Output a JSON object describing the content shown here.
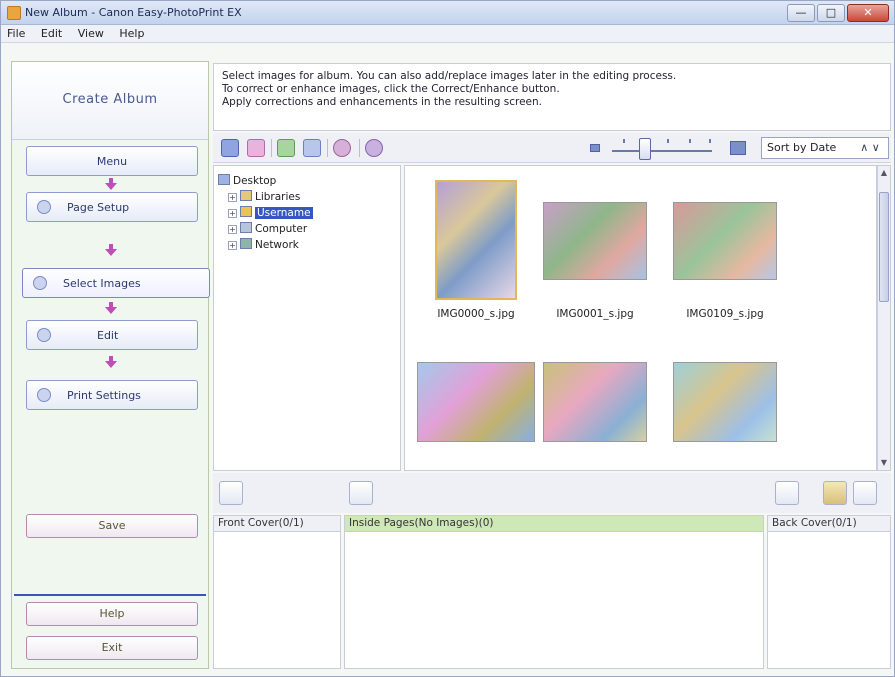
{
  "window": {
    "title": "New Album - Canon Easy-PhotoPrint EX",
    "buttons": {
      "minimize": "—",
      "maximize": "□",
      "close": "✕"
    }
  },
  "menu": [
    "File",
    "Edit",
    "View",
    "Help"
  ],
  "sidebar": {
    "header": "Create Album",
    "steps": [
      {
        "label": "Menu"
      },
      {
        "label": "Page Setup"
      },
      {
        "label": "Select Images"
      },
      {
        "label": "Edit"
      },
      {
        "label": "Print Settings"
      }
    ],
    "save_label": "Save",
    "help_label": "Help",
    "exit_label": "Exit"
  },
  "instructions": {
    "line1": "Select images for album. You can also add/replace images later in the editing process.",
    "line2": "To correct or enhance images, click the Correct/Enhance button.",
    "line3": "Apply corrections and enhancements in the resulting screen."
  },
  "toolbar": {
    "sort": {
      "selected": "Sort by Date",
      "chevron": "∧  ∨"
    },
    "zoom_level": 2
  },
  "tree": {
    "items": [
      {
        "label": "Desktop",
        "exp": ""
      },
      {
        "label": "Libraries",
        "exp": "+"
      },
      {
        "label": "Username",
        "exp": "+"
      },
      {
        "label": "Computer",
        "exp": "+"
      },
      {
        "label": "Network",
        "exp": "+"
      }
    ]
  },
  "thumbnails": [
    {
      "label": "IMG0000_s.jpg",
      "selected": true
    },
    {
      "label": "IMG0001_s.jpg",
      "selected": false
    },
    {
      "label": "IMG0109_s.jpg",
      "selected": false
    },
    {
      "label": "",
      "selected": false
    },
    {
      "label": "",
      "selected": false
    },
    {
      "label": "",
      "selected": false
    }
  ],
  "panes": {
    "front": "Front Cover(0/1)",
    "inside": "Inside Pages(No Images)(0)",
    "back": "Back Cover(0/1)"
  },
  "icons": {
    "title": "app-icon",
    "toolbar": [
      "select-all-icon",
      "deselect-icon",
      "correct-enhance-icon",
      "slideshow-icon",
      "rotate-icon",
      "refresh-icon"
    ],
    "zoom_small": "zoom-small-icon",
    "zoom_large": "zoom-large-icon"
  },
  "colors": {
    "accent": "#3556c4",
    "arrow": "#c04db8",
    "tree_selected": "#3556c4",
    "inside_pages_header": "#cfe8b8"
  }
}
